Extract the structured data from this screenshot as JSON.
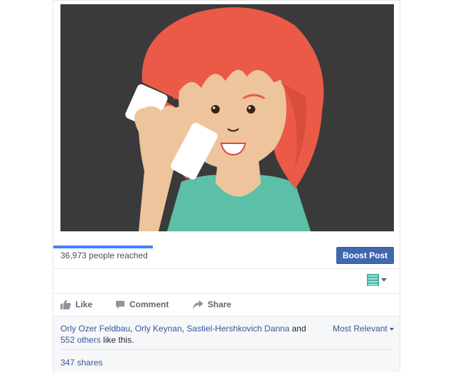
{
  "post": {
    "image_alt": "Cartoon girl with red hair talking on a phone"
  },
  "insights": {
    "reach_text": "36,973 people reached",
    "reach_progress": 0.32,
    "boost_label": "Boost Post"
  },
  "actions": {
    "like_label": "Like",
    "comment_label": "Comment",
    "share_label": "Share"
  },
  "reactions": {
    "name1": "Orly Ozer Feldbau",
    "sep1": ", ",
    "name2": "Orly Keynan",
    "sep2": ", ",
    "name3": "Sastiel-Hershkovich Danna",
    "and": " and ",
    "others": "552 others",
    "suffix": " like this.",
    "sort_label": "Most Relevant",
    "shares_label": "347 shares"
  },
  "colors": {
    "accent": "#4267b2",
    "link": "#365899",
    "progress": "#4080ff",
    "hair": "#ea5a47",
    "shirt": "#5cbfa8",
    "background": "#3a3a3b"
  },
  "icons": [
    "thumbs-up-icon",
    "comment-icon",
    "share-arrow-icon",
    "page-avatar-icon",
    "chevron-down-icon"
  ]
}
